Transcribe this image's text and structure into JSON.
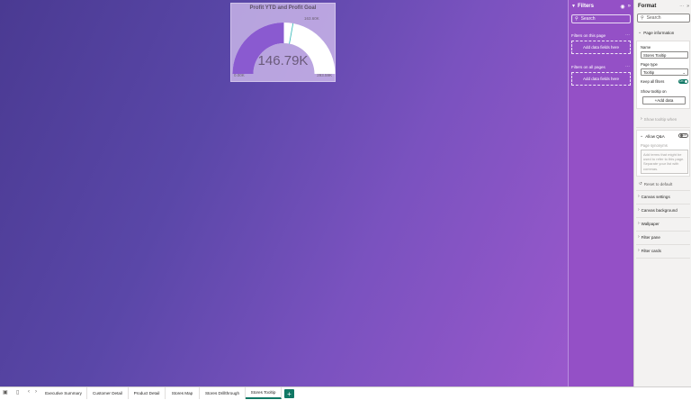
{
  "gauge": {
    "title": "Profit YTD and Profit Goal",
    "value_label": "146.79K",
    "min_label": "0.00K",
    "max_label": "293.59K",
    "target_label": "163.60K",
    "value": 146.79,
    "min": 0,
    "max": 293.59,
    "target": 163.6,
    "fill_color": "#8a5ad0",
    "track_color": "#ffffff",
    "target_color": "#2bb5b5"
  },
  "filters": {
    "title": "Filters",
    "search_placeholder": "Search",
    "on_this_page_label": "Filters on this page",
    "on_all_pages_label": "Filters on all pages",
    "add_fields_label": "Add data fields here",
    "more_icon": "ellipsis-icon"
  },
  "format": {
    "title": "Format",
    "search_placeholder": "Search",
    "page_information": "Page information",
    "name_label": "Name",
    "name_value": "Stores Tooltip",
    "page_type_label": "Page type",
    "page_type_value": "Tooltip",
    "keep_all_filters_label": "Keep all filters",
    "keep_all_filters_state": "On",
    "show_tooltip_on_label": "Show tooltip on",
    "add_data_label": "+Add data",
    "show_tooltip_when_label": "Show tooltip when",
    "allow_qa_label": "Allow Q&A",
    "allow_qa_state": "Off",
    "page_synonyms_label": "Page synonyms",
    "page_synonyms_placeholder": "Add terms that might be used to refer to this page. Separate your list with commas.",
    "reset_label": "Reset to default",
    "sections": [
      "Canvas settings",
      "Canvas background",
      "Wallpaper",
      "Filter pane",
      "Filter cards"
    ]
  },
  "tabs": {
    "items": [
      "Executive Summary",
      "Customer Detail",
      "Product Detail",
      "Stores Map",
      "Stores Drillthrough",
      "Stores Tooltip"
    ],
    "active_index": 5,
    "add_label": "+"
  },
  "colors": {
    "accent": "#117865",
    "filters_pane": "#9450c6"
  }
}
